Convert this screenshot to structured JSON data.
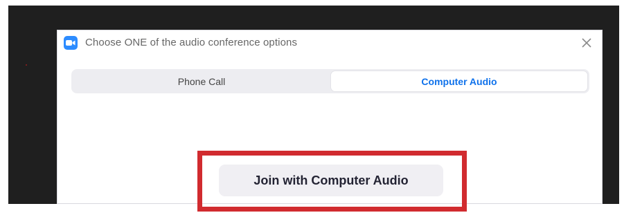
{
  "dialog": {
    "title": "Choose ONE of the audio conference options",
    "app_icon": "zoom-camera-icon",
    "close_icon": "close-icon"
  },
  "tabs": [
    {
      "label": "Phone Call",
      "selected": false
    },
    {
      "label": "Computer Audio",
      "selected": true
    }
  ],
  "join_button": {
    "label": "Join with Computer Audio"
  },
  "colors": {
    "accent": "#0e71eb",
    "app_icon": "#2d8cff",
    "highlight": "#d12b2f",
    "backdrop": "#1f1f1f"
  }
}
